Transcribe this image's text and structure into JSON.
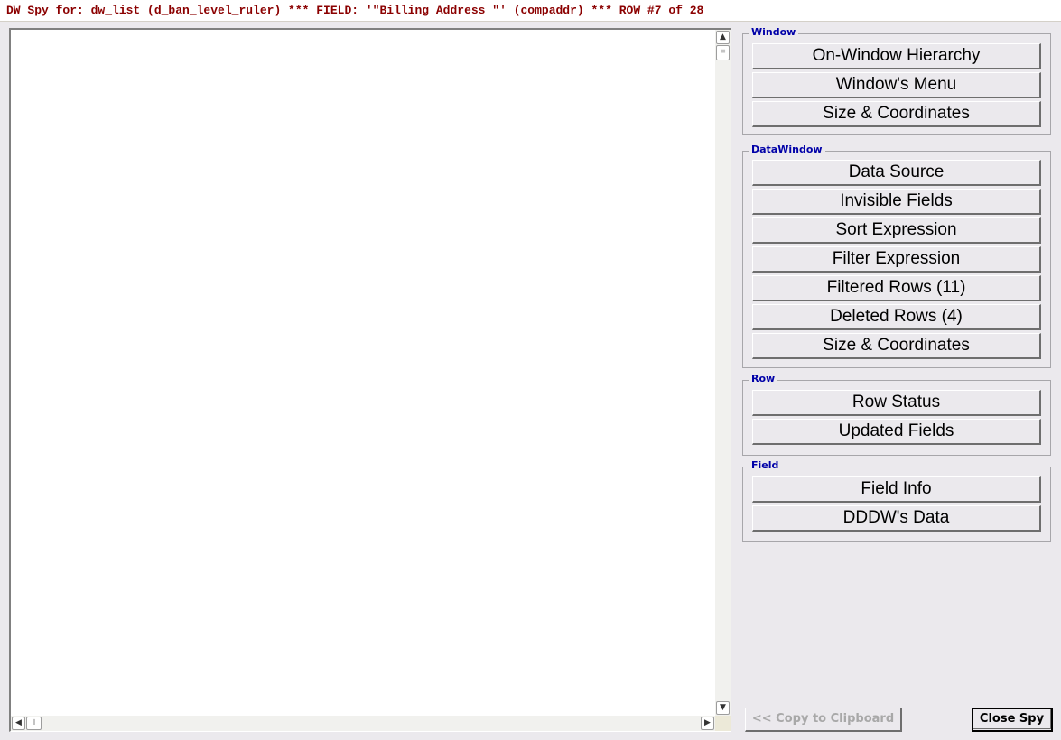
{
  "window": {
    "title": "DW Spy for: dw_list (d_ban_level_ruler) *** FIELD: '\"Billing Address \"' (compaddr) *** ROW #7 of 28"
  },
  "groups": {
    "window": {
      "label": "Window",
      "buttons": [
        "On-Window Hierarchy",
        "Window's Menu",
        "Size & Coordinates"
      ]
    },
    "datawindow": {
      "label": "DataWindow",
      "buttons": [
        "Data Source",
        "Invisible Fields",
        "Sort Expression",
        "Filter Expression",
        "Filtered Rows (11)",
        "Deleted Rows (4)",
        "Size & Coordinates"
      ]
    },
    "row": {
      "label": "Row",
      "buttons": [
        "Row Status",
        "Updated Fields"
      ]
    },
    "field": {
      "label": "Field",
      "buttons": [
        "Field Info",
        "DDDW's Data"
      ]
    }
  },
  "footer": {
    "copy_label": "<< Copy to Clipboard",
    "close_label": "Close Spy"
  },
  "icons": {
    "close": "close-icon",
    "scroll_up": "chevron-up-icon",
    "scroll_down": "chevron-down-icon",
    "scroll_left": "chevron-left-icon",
    "scroll_right": "chevron-right-icon"
  },
  "colors": {
    "title_text": "#8b0000",
    "group_label": "#0000a8",
    "background": "#ebe9ed"
  }
}
